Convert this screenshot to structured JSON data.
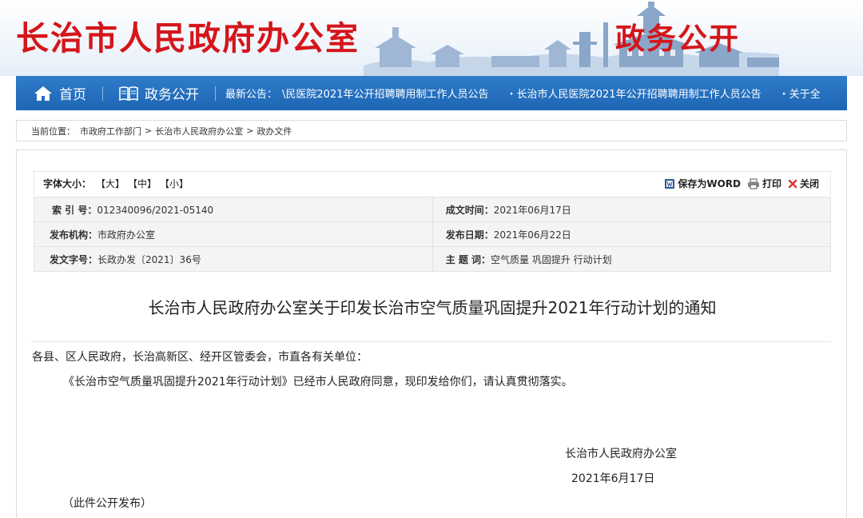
{
  "header": {
    "site_title": "长治市人民政府办公室",
    "section_title": "政务公开"
  },
  "nav": {
    "home_label": "首页",
    "open_gov_label": "政务公开",
    "news_label": "最新公告：",
    "news_items": [
      "\\民医院2021年公开招聘聘用制工作人员公告",
      "・长治市人民医院2021年公开招聘聘用制工作人员公告",
      "・关于全"
    ]
  },
  "breadcrumb": {
    "label": "当前位置：",
    "items": [
      "市政府工作部门",
      "长治市人民政府办公室",
      "政办文件"
    ],
    "separator": ">"
  },
  "toolbar": {
    "font_size_label": "字体大小：",
    "font_options": [
      "【大】",
      "【中】",
      "【小】"
    ],
    "save_word": "保存为WORD",
    "print": "打印",
    "close": "关闭"
  },
  "meta": {
    "index_label": "索 引 号：",
    "index_value": "012340096/2021-05140",
    "created_label": "成文时间：",
    "created_value": "2021年06月17日",
    "publisher_label": "发布机构：",
    "publisher_value": "市政府办公室",
    "pubdate_label": "发布日期：",
    "pubdate_value": "2021年06月22日",
    "docno_label": "发文字号：",
    "docno_value": "长政办发〔2021〕36号",
    "keywords_label": "主 题 词：",
    "keywords_value": "空气质量 巩固提升 行动计划"
  },
  "document": {
    "title": "长治市人民政府办公室关于印发长治市空气质量巩固提升2021年行动计划的通知",
    "recipient": "各县、区人民政府，长治高新区、经开区管委会，市直各有关单位：",
    "body": "《长治市空气质量巩固提升2021年行动计划》已经市人民政府同意，现印发给你们，请认真贯彻落实。",
    "sign_org": "长治市人民政府办公室",
    "sign_date": "2021年6月17日",
    "publish_note": "（此件公开发布）"
  },
  "colors": {
    "brand_red": "#d4161b",
    "nav_blue": "#1e66b5"
  }
}
